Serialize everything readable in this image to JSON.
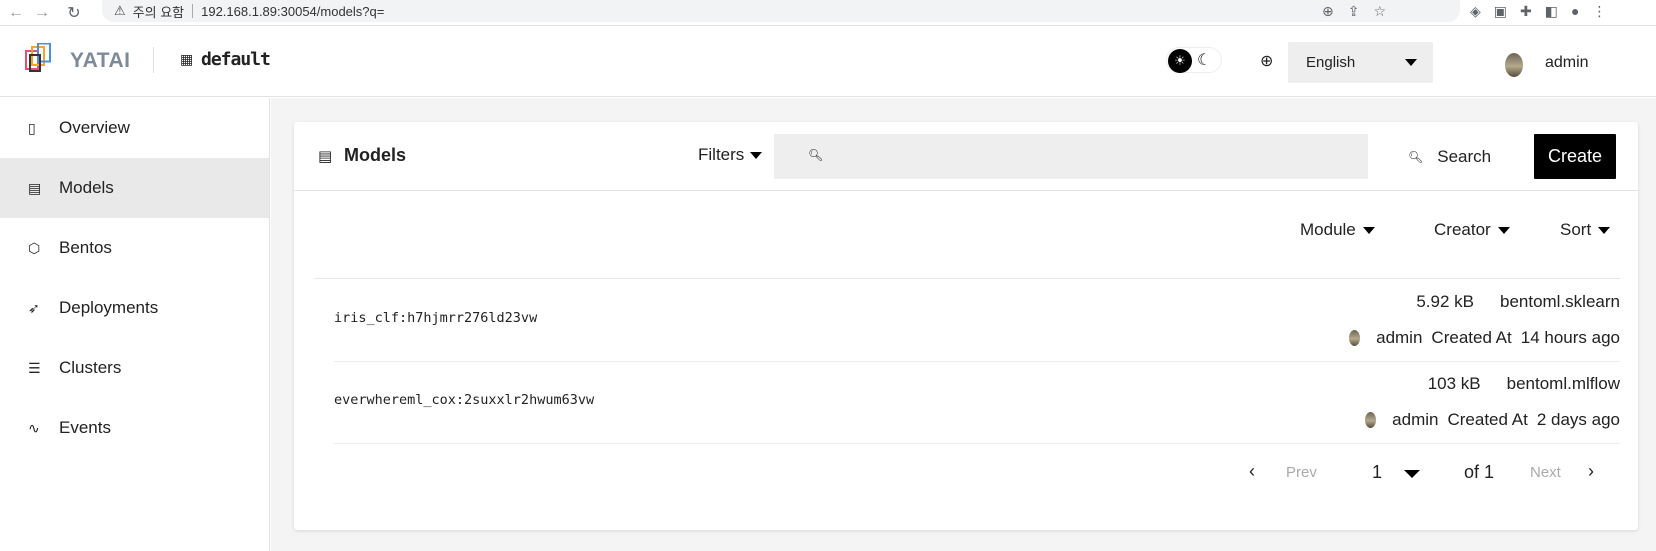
{
  "browser": {
    "back_icon": "←",
    "forward_icon": "→",
    "reload_icon": "↻",
    "warning_text": "주의 요함",
    "url": "192.168.1.89:30054/models?q="
  },
  "header": {
    "logo_text": "YATAI",
    "org_name": "default",
    "language": "English",
    "user_name": "admin"
  },
  "sidebar": {
    "items": [
      {
        "label": "Overview",
        "icon": "clipboard-icon",
        "glyph": "▯"
      },
      {
        "label": "Models",
        "icon": "model-icon",
        "glyph": "▤"
      },
      {
        "label": "Bentos",
        "icon": "box-icon",
        "glyph": "⬡"
      },
      {
        "label": "Deployments",
        "icon": "rocket-icon",
        "glyph": "➶"
      },
      {
        "label": "Clusters",
        "icon": "server-icon",
        "glyph": "☰"
      },
      {
        "label": "Events",
        "icon": "activity-icon",
        "glyph": "∿"
      }
    ]
  },
  "main": {
    "title": "Models",
    "filters_label": "Filters",
    "search_placeholder": "",
    "search_label": "Search",
    "create_label": "Create",
    "sort_options": [
      "Module",
      "Creator",
      "Sort"
    ],
    "models": [
      {
        "name": "iris_clf:h7hjmrr276ld23vw",
        "size": "5.92 kB",
        "module": "bentoml.sklearn",
        "creator": "admin",
        "created_label": "Created At",
        "created": "14 hours ago"
      },
      {
        "name": "everwhereml_cox:2suxxlr2hwum63vw",
        "size": "103 kB",
        "module": "bentoml.mlflow",
        "creator": "admin",
        "created_label": "Created At",
        "created": "2 days ago"
      }
    ],
    "pagination": {
      "prev": "Prev",
      "page": "1",
      "of": "of 1",
      "next": "Next"
    }
  },
  "colors": {
    "accent": "#000000",
    "active_sidebar": "#e9e9e9",
    "main_bg": "#f4f4f4"
  }
}
